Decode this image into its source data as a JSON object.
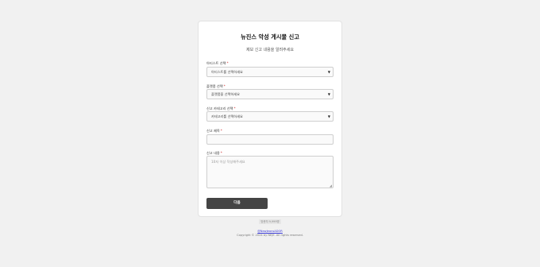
{
  "page": {
    "title": "뉴진스 악성 게시물 신고",
    "subtitle": "제보 신고 내용을 알려주세요"
  },
  "form": {
    "artist": {
      "label": "아티스트 선택",
      "required_mark": "*",
      "value": "아티스트를 선택하세요"
    },
    "platform": {
      "label": "플랫폼 선택",
      "required_mark": "*",
      "value": "플랫폼을 선택하세요"
    },
    "category": {
      "label": "신고 카테고리 선택",
      "required_mark": "*",
      "value": "카테고리를 선택하세요"
    },
    "report_title": {
      "label": "신고 제목",
      "required_mark": "*",
      "value": ""
    },
    "report_content": {
      "label": "신고 내용",
      "required_mark": "*",
      "placeholder": "10자 이상 작성해주세요"
    },
    "submit_label": "다음"
  },
  "visitor_counter": "방문자 9,999명",
  "footer": {
    "link": "@NewJeansADOR",
    "copyright": "Copyright © 2024 by NEJE. All rights reserved."
  },
  "colors": {
    "button": "#444444",
    "background": "#f1f1f1",
    "required": "#cc2222"
  }
}
